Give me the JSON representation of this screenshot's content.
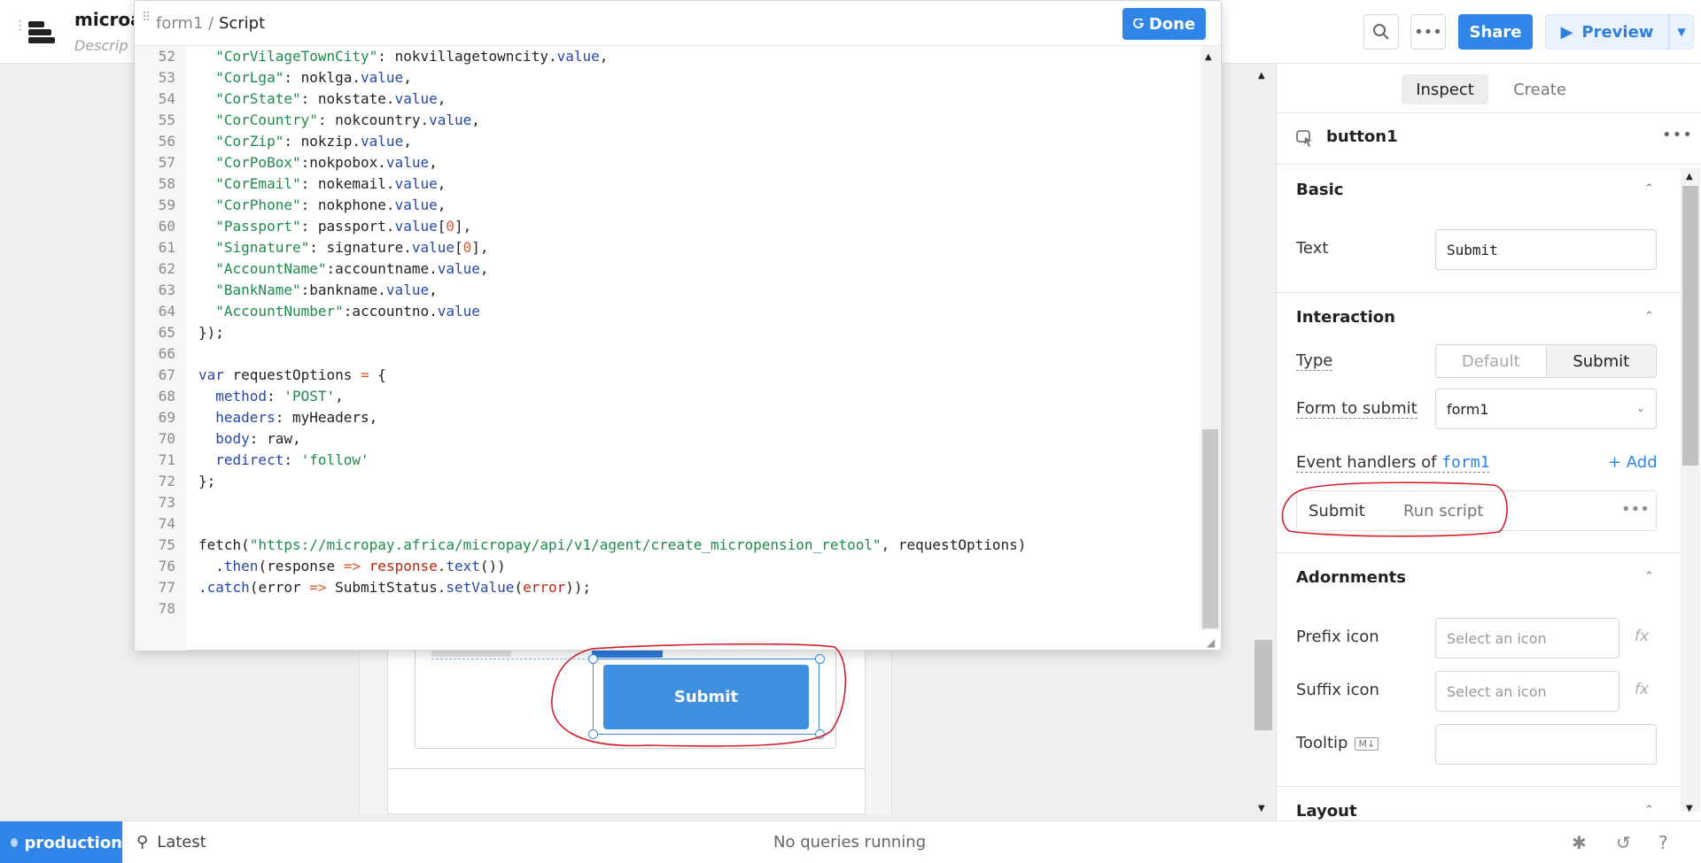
{
  "header": {
    "app_name": "microa",
    "app_description": "Descrip",
    "share_label": "Share",
    "preview_label": "Preview"
  },
  "editor": {
    "breadcrumb_parent": "form1",
    "breadcrumb_sep": " / ",
    "breadcrumb_current": "Script",
    "done_label": "Done",
    "lines": [
      {
        "n": "52",
        "t": [
          [
            "  ",
            ""
          ],
          [
            "\"CorVilageTownCity\"",
            "str"
          ],
          [
            ": nokvillagetowncity.",
            ""
          ],
          [
            "value",
            "prop"
          ],
          [
            ",",
            ""
          ]
        ]
      },
      {
        "n": "53",
        "t": [
          [
            "  ",
            ""
          ],
          [
            "\"CorLga\"",
            "str"
          ],
          [
            ": noklga.",
            ""
          ],
          [
            "value",
            "prop"
          ],
          [
            ",",
            ""
          ]
        ]
      },
      {
        "n": "54",
        "t": [
          [
            "  ",
            ""
          ],
          [
            "\"CorState\"",
            "str"
          ],
          [
            ": nokstate.",
            ""
          ],
          [
            "value",
            "prop"
          ],
          [
            ",",
            ""
          ]
        ]
      },
      {
        "n": "55",
        "t": [
          [
            "  ",
            ""
          ],
          [
            "\"CorCountry\"",
            "str"
          ],
          [
            ": nokcountry.",
            ""
          ],
          [
            "value",
            "prop"
          ],
          [
            ",",
            ""
          ]
        ]
      },
      {
        "n": "56",
        "t": [
          [
            "  ",
            ""
          ],
          [
            "\"CorZip\"",
            "str"
          ],
          [
            ": nokzip.",
            ""
          ],
          [
            "value",
            "prop"
          ],
          [
            ",",
            ""
          ]
        ]
      },
      {
        "n": "57",
        "t": [
          [
            "  ",
            ""
          ],
          [
            "\"CorPoBox\"",
            "str"
          ],
          [
            ":nokpobox.",
            ""
          ],
          [
            "value",
            "prop"
          ],
          [
            ",",
            ""
          ]
        ]
      },
      {
        "n": "58",
        "t": [
          [
            "  ",
            ""
          ],
          [
            "\"CorEmail\"",
            "str"
          ],
          [
            ": nokemail.",
            ""
          ],
          [
            "value",
            "prop"
          ],
          [
            ",",
            ""
          ]
        ]
      },
      {
        "n": "59",
        "t": [
          [
            "  ",
            ""
          ],
          [
            "\"CorPhone\"",
            "str"
          ],
          [
            ": nokphone.",
            ""
          ],
          [
            "value",
            "prop"
          ],
          [
            ",",
            ""
          ]
        ]
      },
      {
        "n": "60",
        "t": [
          [
            "  ",
            ""
          ],
          [
            "\"Passport\"",
            "str"
          ],
          [
            ": passport.",
            ""
          ],
          [
            "value",
            "prop"
          ],
          [
            "[",
            ""
          ],
          [
            "0",
            "num"
          ],
          [
            "],",
            ""
          ]
        ]
      },
      {
        "n": "61",
        "t": [
          [
            "  ",
            ""
          ],
          [
            "\"Signature\"",
            "str"
          ],
          [
            ": signature.",
            ""
          ],
          [
            "value",
            "prop"
          ],
          [
            "[",
            ""
          ],
          [
            "0",
            "num"
          ],
          [
            "],",
            ""
          ]
        ]
      },
      {
        "n": "62",
        "t": [
          [
            "  ",
            ""
          ],
          [
            "\"AccountName\"",
            "str"
          ],
          [
            ":accountname.",
            ""
          ],
          [
            "value",
            "prop"
          ],
          [
            ",",
            ""
          ]
        ]
      },
      {
        "n": "63",
        "t": [
          [
            "  ",
            ""
          ],
          [
            "\"BankName\"",
            "str"
          ],
          [
            ":bankname.",
            ""
          ],
          [
            "value",
            "prop"
          ],
          [
            ",",
            ""
          ]
        ]
      },
      {
        "n": "64",
        "t": [
          [
            "  ",
            ""
          ],
          [
            "\"AccountNumber\"",
            "str"
          ],
          [
            ":accountno.",
            ""
          ],
          [
            "value",
            "prop"
          ]
        ]
      },
      {
        "n": "65",
        "t": [
          [
            "});",
            ""
          ]
        ]
      },
      {
        "n": "66",
        "t": []
      },
      {
        "n": "67",
        "t": [
          [
            "var",
            "kw"
          ],
          [
            " requestOptions ",
            ""
          ],
          [
            "=",
            "op"
          ],
          [
            " {",
            ""
          ]
        ]
      },
      {
        "n": "68",
        "t": [
          [
            "  ",
            ""
          ],
          [
            "method",
            "prop"
          ],
          [
            ": ",
            ""
          ],
          [
            "'POST'",
            "str"
          ],
          [
            ",",
            ""
          ]
        ]
      },
      {
        "n": "69",
        "t": [
          [
            "  ",
            ""
          ],
          [
            "headers",
            "prop"
          ],
          [
            ": myHeaders,",
            ""
          ]
        ]
      },
      {
        "n": "70",
        "t": [
          [
            "  ",
            ""
          ],
          [
            "body",
            "prop"
          ],
          [
            ": raw,",
            ""
          ]
        ]
      },
      {
        "n": "71",
        "t": [
          [
            "  ",
            ""
          ],
          [
            "redirect",
            "prop"
          ],
          [
            ": ",
            ""
          ],
          [
            "'follow'",
            "str"
          ]
        ]
      },
      {
        "n": "72",
        "t": [
          [
            "};",
            ""
          ]
        ]
      },
      {
        "n": "73",
        "t": []
      },
      {
        "n": "74",
        "t": []
      },
      {
        "n": "75",
        "t": [
          [
            "fetch(",
            ""
          ],
          [
            "\"https://micropay.africa/micropay/api/v1/agent/create_micropension_retool\"",
            "str"
          ],
          [
            ", requestOptions)",
            ""
          ]
        ]
      },
      {
        "n": "76",
        "t": [
          [
            "  .",
            ""
          ],
          [
            "then",
            "fn"
          ],
          [
            "(response ",
            ""
          ],
          [
            "=>",
            "op"
          ],
          [
            " ",
            ""
          ],
          [
            "response",
            "err"
          ],
          [
            ".",
            ""
          ],
          [
            "text",
            "fn"
          ],
          [
            "())",
            ""
          ]
        ]
      },
      {
        "n": "77",
        "t": [
          [
            ".",
            ""
          ],
          [
            "catch",
            "fn"
          ],
          [
            "(error ",
            ""
          ],
          [
            "=>",
            "op"
          ],
          [
            " SubmitStatus.",
            ""
          ],
          [
            "setValue",
            "fn"
          ],
          [
            "(",
            ""
          ],
          [
            "error",
            "err"
          ],
          [
            "));",
            ""
          ]
        ]
      },
      {
        "n": "78",
        "t": []
      }
    ]
  },
  "canvas": {
    "submit_label": "Submit"
  },
  "panel": {
    "tab_inspect": "Inspect",
    "tab_create": "Create",
    "component_name": "button1",
    "sections": {
      "basic": "Basic",
      "interaction": "Interaction",
      "adornments": "Adornments",
      "layout": "Layout"
    },
    "text_label": "Text",
    "text_value": "Submit",
    "type_label": "Type",
    "type_options": [
      "Default",
      "Submit"
    ],
    "type_selected": "Submit",
    "form_label": "Form to submit",
    "form_value": "form1",
    "event_handlers_prefix": "Event handlers of",
    "event_handlers_target": "form1",
    "add_label": "+ Add",
    "handler_event": "Submit",
    "handler_action": "Run script",
    "prefix_label": "Prefix icon",
    "prefix_placeholder": "Select an icon",
    "suffix_label": "Suffix icon",
    "suffix_placeholder": "Select an icon",
    "tooltip_label": "Tooltip",
    "tooltip_badge": "M↓",
    "fx_label": "fx"
  },
  "status": {
    "env": "production",
    "latest": "Latest",
    "queries": "No queries running"
  },
  "colors": {
    "accent": "#2f86e8",
    "annotation": "#d21f2f"
  }
}
